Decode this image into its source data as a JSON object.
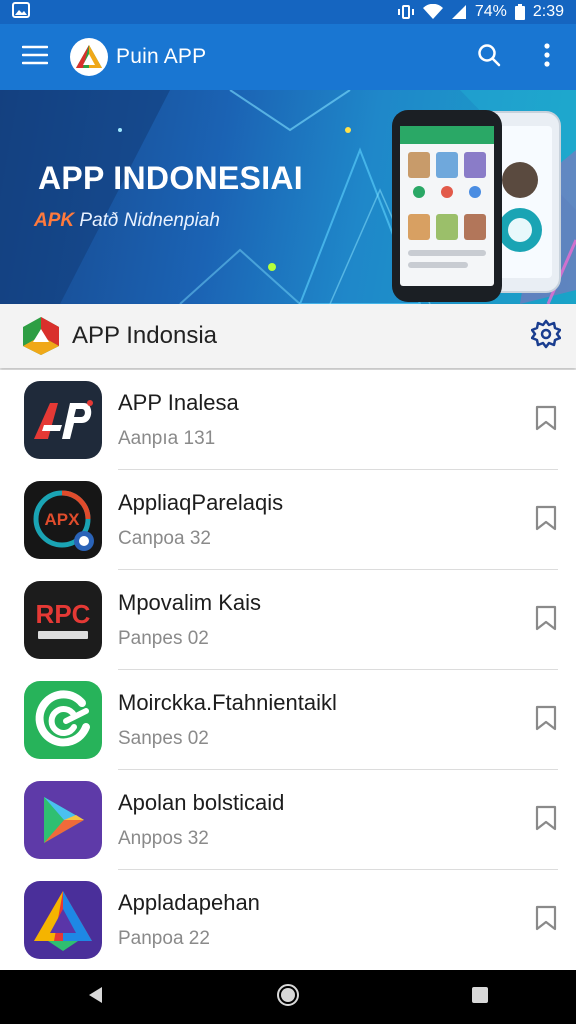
{
  "status_bar": {
    "battery": "74%",
    "time": "2:39"
  },
  "app_bar": {
    "title": "Puin APP"
  },
  "banner": {
    "title": "APP INDONESIAI",
    "subtitle_accent": "APK",
    "subtitle": "Patð Nidnenpiah"
  },
  "section": {
    "title": "APP Indonsia"
  },
  "apps": [
    {
      "name": "APP Inalesa",
      "meta": "Aanpıa 131",
      "icon": "ap-red-logo-icon"
    },
    {
      "name": "AppliaqParelaqis",
      "meta": "Canpoa 32",
      "icon": "apk-circle-icon"
    },
    {
      "name": "Mpovalim Kais",
      "meta": "Panpes 02",
      "icon": "rpc-logo-icon"
    },
    {
      "name": "Moirckka.Ftahnientaikl",
      "meta": "Sanpes 02",
      "icon": "green-ring-icon"
    },
    {
      "name": "Apolan bolsticaid",
      "meta": "Anppos 32",
      "icon": "play-triangle-icon"
    },
    {
      "name": "Appladapehan",
      "meta": "Panpoa 22",
      "icon": "colorful-triangle-icon"
    }
  ],
  "colors": {
    "status_bar": "#1565c0",
    "app_bar": "#1976d2",
    "accent": "#ff7a3d"
  }
}
